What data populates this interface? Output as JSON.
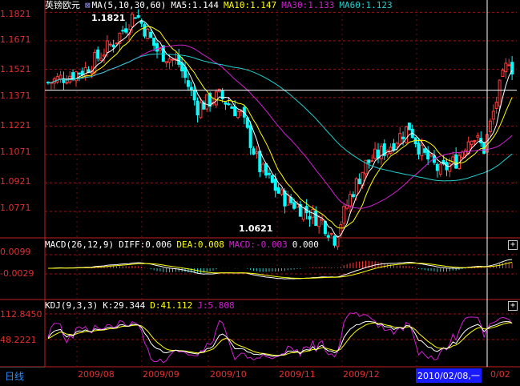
{
  "chart_data": [
    {
      "type": "line",
      "title": "英镑欧元",
      "indicator": "MA(5,10,30,60)",
      "legend": [
        {
          "label": "MA5:1.144",
          "color": "#ffffff"
        },
        {
          "label": "MA10:1.147",
          "color": "#ffff00"
        },
        {
          "label": "MA30:1.133",
          "color": "#d020d0"
        },
        {
          "label": "MA60:1.123",
          "color": "#20d0d0"
        }
      ],
      "y_ticks": [
        "1.1821",
        "1.1671",
        "1.1521",
        "1.1371",
        "1.1221",
        "1.1071",
        "1.0921",
        "1.0771"
      ],
      "ylim": [
        1.064,
        1.1835
      ],
      "annotations": [
        {
          "text": "1.1821",
          "x": "2009/07",
          "y": 1.1821
        },
        {
          "text": "1.0621",
          "x": "2009/10",
          "y": 1.0621
        }
      ],
      "x_ticks": [
        "2009/08",
        "2009/09",
        "2009/10",
        "2009/11",
        "2009/12"
      ],
      "candlesticks": {
        "up_color": "#ff3b3b",
        "down_color": "#00ffff"
      },
      "series": [
        {
          "name": "MA5",
          "color": "#ffffff"
        },
        {
          "name": "MA10",
          "color": "#ffff00"
        },
        {
          "name": "MA30",
          "color": "#d020d0"
        },
        {
          "name": "MA60",
          "color": "#20d0d0"
        }
      ]
    },
    {
      "type": "bar",
      "title": "MACD(26,12,9)",
      "legend": [
        {
          "label": "DIFF:0.006",
          "color": "#ffffff"
        },
        {
          "label": "DEA:0.008",
          "color": "#ffff00"
        },
        {
          "label": "MACD:-0.003",
          "color": "#d020d0"
        },
        {
          "label": "0.000",
          "color": "#ffffff"
        }
      ],
      "y_ticks": [
        "0.0099",
        "-0.0029"
      ]
    },
    {
      "type": "line",
      "title": "KDJ(9,3,3)",
      "legend": [
        {
          "label": "K:29.344",
          "color": "#ffffff"
        },
        {
          "label": "D:41.112",
          "color": "#ffff00"
        },
        {
          "label": "J:5.808",
          "color": "#d020d0"
        }
      ],
      "y_ticks": [
        "112.8450",
        "48.2221"
      ]
    }
  ],
  "footer": {
    "period": "日线",
    "cursor_date": "2010/02/08,一",
    "cursor_tail": "0/02"
  },
  "buttons": {
    "macd_expand": "+",
    "kdj_expand": "+"
  }
}
